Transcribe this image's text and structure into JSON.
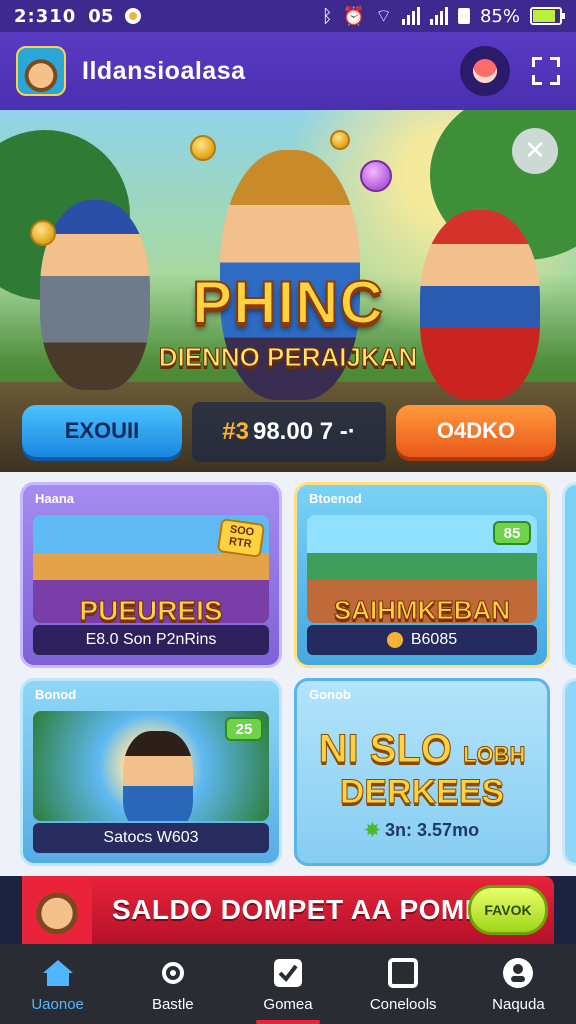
{
  "status_bar": {
    "time": "2:310",
    "carrier": "05",
    "battery": "85%"
  },
  "app_bar": {
    "title": "Ildansioalasa"
  },
  "hero": {
    "title": "PHINC",
    "subtitle": "DIENNO PERAIJKAN",
    "left_button": "EXOUII",
    "balance_currency": "#3",
    "balance_value": "98.00 7 -·",
    "right_button": "O4DKO",
    "close_icon": "close-icon"
  },
  "cards": [
    {
      "tag": "Haana",
      "name": "PUEUREIS",
      "info": "E8.0 Son P2nRins",
      "badge": "SOO RTR",
      "colors": {
        "bg": "#8e73e4"
      }
    },
    {
      "tag": "Btoenod",
      "name": "SAIHMKEBAN",
      "info": "B6085",
      "badge": "85",
      "colors": {
        "bg": "#5ab8e8"
      }
    },
    {
      "tag": "Bonod",
      "name": "",
      "info": "Satocs W603",
      "badge": "25",
      "colors": {
        "bg": "#6fc4ee"
      }
    },
    {
      "tag": "Gonob",
      "name_line1": "NI SLO",
      "name_small": "LOBH",
      "name_line2": "DERKEES",
      "info": "3n: 3.57mo",
      "colors": {
        "bg": "#9fd9f6"
      }
    }
  ],
  "promo": {
    "text": "SALDO DOMPET AA POMM",
    "button": "FAVOK"
  },
  "nav": {
    "items": [
      {
        "label": "Uaonoe",
        "icon": "home-icon",
        "active": true
      },
      {
        "label": "Bastle",
        "icon": "gear-icon",
        "active": false
      },
      {
        "label": "Gomea",
        "icon": "check-icon",
        "active": false
      },
      {
        "label": "Conelools",
        "icon": "square-icon",
        "active": false
      },
      {
        "label": "Naquda",
        "icon": "profile-icon",
        "active": false
      }
    ]
  }
}
